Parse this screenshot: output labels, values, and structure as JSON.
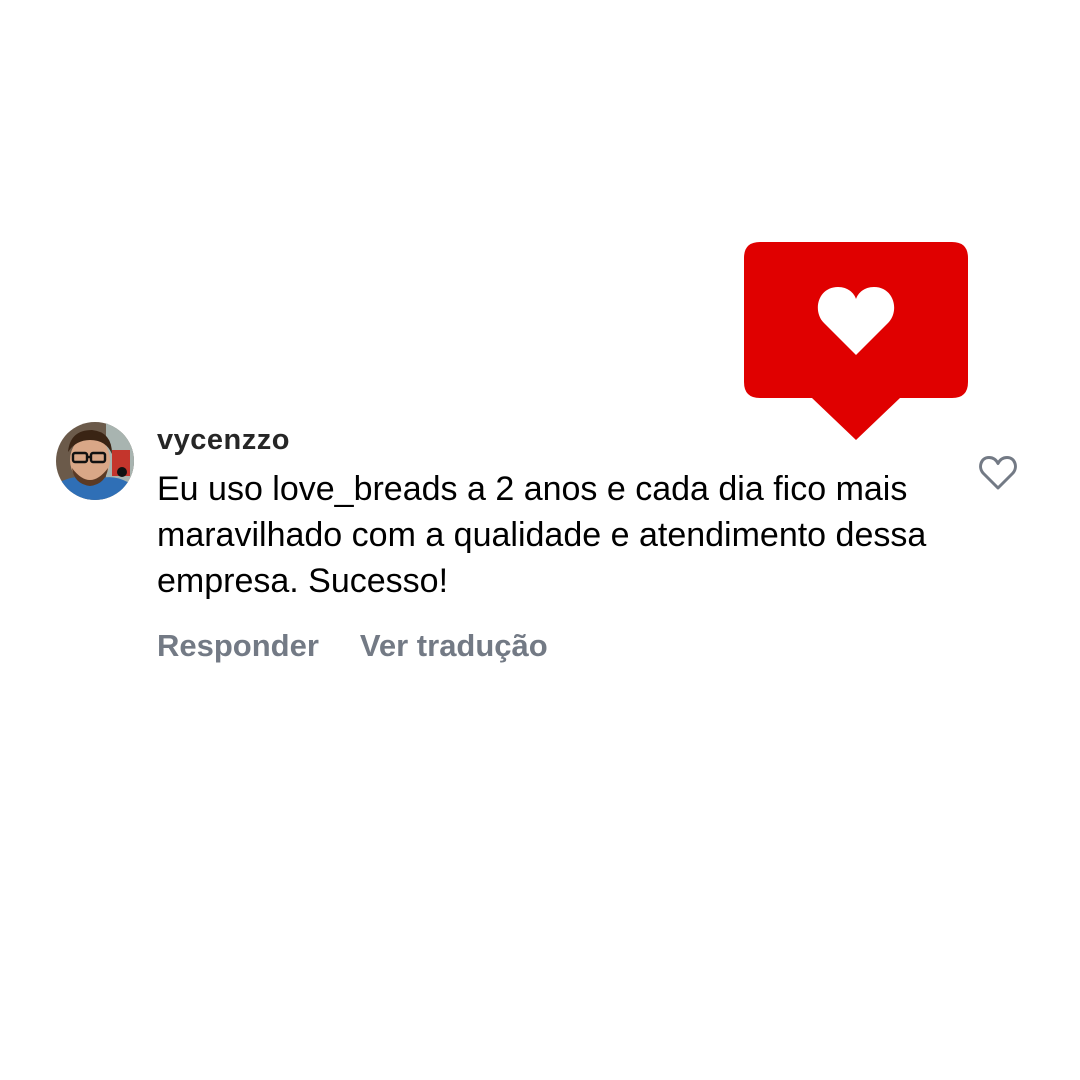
{
  "notification": {
    "icon": "heart-icon",
    "background_color": "#e00000",
    "heart_color": "#ffffff"
  },
  "comment": {
    "username": "vycenzzo",
    "text": "Eu uso love_breads a 2 anos e cada dia fico mais maravilhado com a qualidade e atendimento dessa empresa. Sucesso!",
    "actions": {
      "reply_label": "Responder",
      "translate_label": "Ver tradução"
    },
    "like_icon": "heart-outline-icon",
    "muted_color": "#737a85"
  }
}
